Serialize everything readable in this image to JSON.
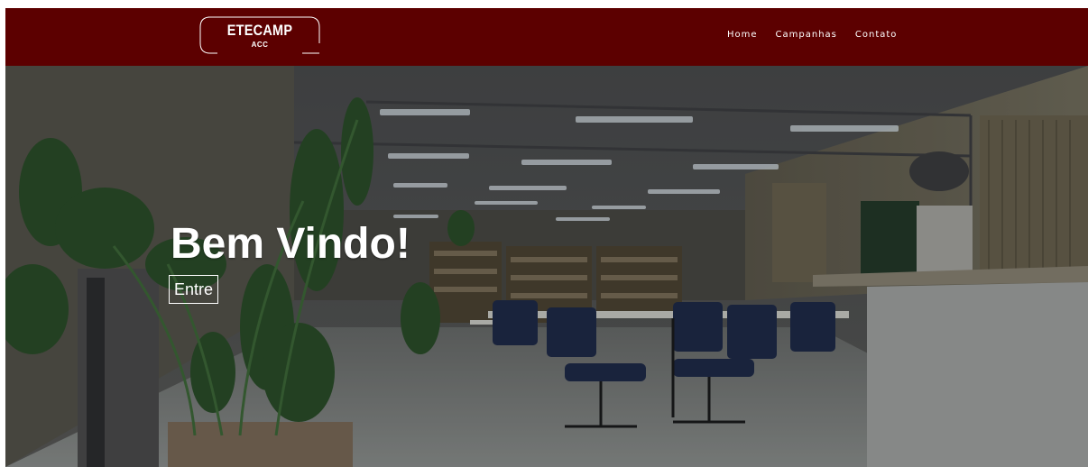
{
  "navbar": {
    "background_color": "#5c0000",
    "logo": {
      "title": "ETECAMP",
      "subtitle": "ACC"
    },
    "links": [
      {
        "label": "Home"
      },
      {
        "label": "Campanhas"
      },
      {
        "label": "Contato"
      }
    ]
  },
  "hero": {
    "title": "Bem Vindo!",
    "button_label": "Entre",
    "background_image": "dimmed photo of a school library with bookshelves, blue chairs, tables and a potted plant"
  }
}
